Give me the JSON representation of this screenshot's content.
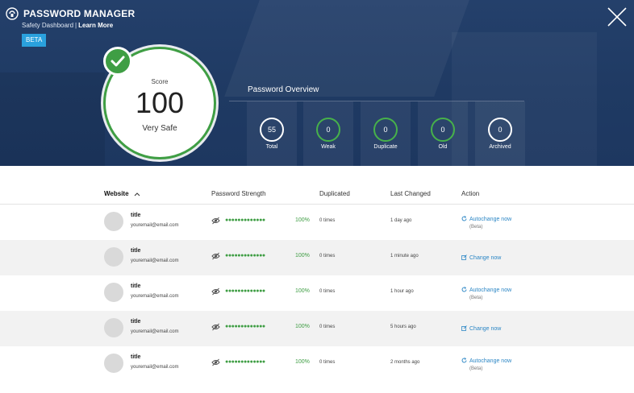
{
  "header": {
    "app_title": "PASSWORD MANAGER",
    "subtitle": "Safety Dashboard",
    "separator": "|",
    "learn_more": "Learn More",
    "beta_badge": "BETA"
  },
  "score": {
    "label": "Score",
    "value": "100",
    "status": "Very Safe"
  },
  "overview": {
    "title": "Password Overview",
    "tiles": [
      {
        "value": "55",
        "label": "Total",
        "ring": "white"
      },
      {
        "value": "0",
        "label": "Weak",
        "ring": "green"
      },
      {
        "value": "0",
        "label": "Duplicate",
        "ring": "green"
      },
      {
        "value": "0",
        "label": "Old",
        "ring": "green"
      },
      {
        "value": "0",
        "label": "Archived",
        "ring": "white"
      }
    ]
  },
  "table": {
    "columns": {
      "website": "Website",
      "strength": "Password Strength",
      "duplicated": "Duplicated",
      "last_changed": "Last Changed",
      "action": "Action"
    },
    "rows": [
      {
        "title": "title",
        "email": "youremail@email.com",
        "strength_dots": "●●●●●●●●●●●●●",
        "strength": "100%",
        "duplicated": "0 times",
        "last_changed": "1 day ago",
        "action": "Autochange now",
        "action_sub": "(Beta)",
        "action_icon": "refresh-icon"
      },
      {
        "title": "title",
        "email": "youremail@email.com",
        "strength_dots": "●●●●●●●●●●●●●",
        "strength": "100%",
        "duplicated": "0 times",
        "last_changed": "1 minute ago",
        "action": "Change now",
        "action_sub": "",
        "action_icon": "external-link-icon"
      },
      {
        "title": "title",
        "email": "youremail@email.com",
        "strength_dots": "●●●●●●●●●●●●●",
        "strength": "100%",
        "duplicated": "0 times",
        "last_changed": "1 hour ago",
        "action": "Autochange now",
        "action_sub": "(Beta)",
        "action_icon": "refresh-icon"
      },
      {
        "title": "title",
        "email": "youremail@email.com",
        "strength_dots": "●●●●●●●●●●●●●",
        "strength": "100%",
        "duplicated": "0 times",
        "last_changed": "5 hours ago",
        "action": "Change now",
        "action_sub": "",
        "action_icon": "external-link-icon"
      },
      {
        "title": "title",
        "email": "youremail@email.com",
        "strength_dots": "●●●●●●●●●●●●●",
        "strength": "100%",
        "duplicated": "0 times",
        "last_changed": "2 months ago",
        "action": "Autochange now",
        "action_sub": "(Beta)",
        "action_icon": "refresh-icon"
      }
    ]
  },
  "colors": {
    "header_bg": "#1f3a63",
    "accent_green": "#3f9e44",
    "link_blue": "#2b86c5",
    "beta_blue": "#2aa1dd"
  }
}
